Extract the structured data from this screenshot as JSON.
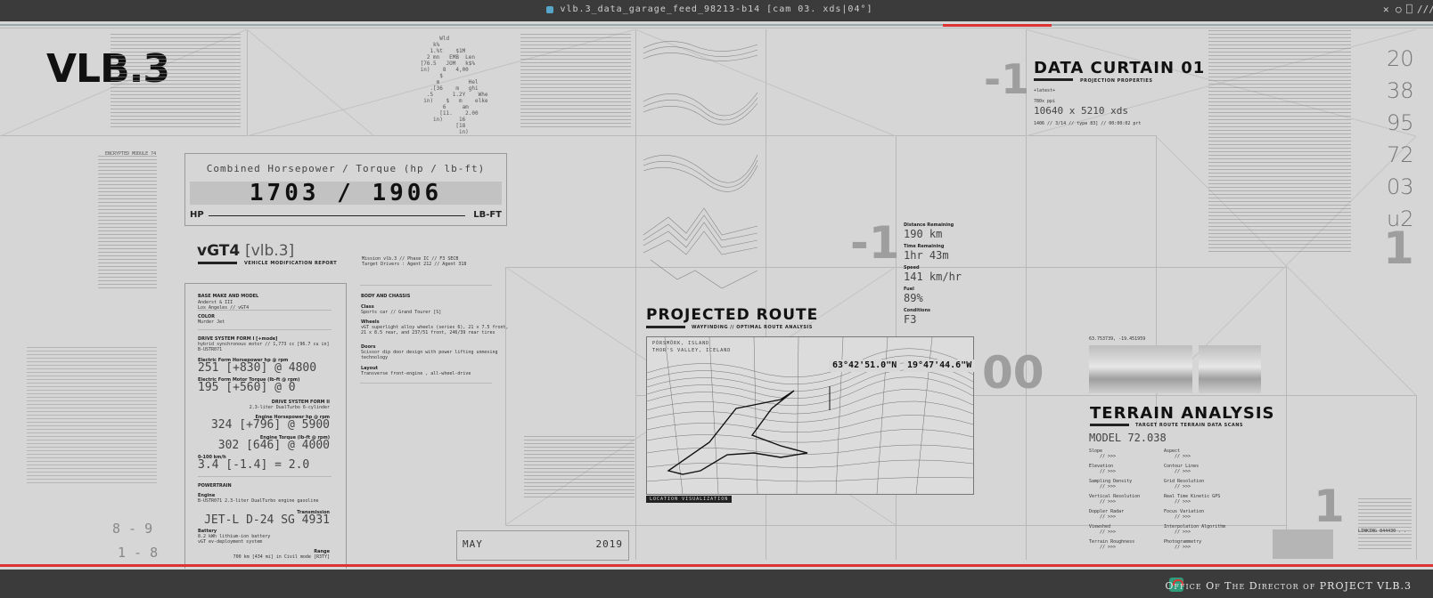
{
  "window": {
    "title": "vlb.3_data_garage_feed_98213-b14 [cam 03. xds|04°]",
    "controls": [
      "✕",
      "○",
      "⎕",
      "///"
    ]
  },
  "logo": "VLB.3",
  "left_text": {
    "encrypted": "ENCRYPTED MODULE 74",
    "nums_bottom": [
      "8 - 9",
      "1 - 8"
    ]
  },
  "horsepower": {
    "label": "Combined Horsepower / Torque (hp / lb-ft)",
    "value": "1703 / 1906",
    "left_unit": "HP",
    "right_unit": "LB-FT"
  },
  "report": {
    "title": "vGT4",
    "title_bracket": "[vlb.3]",
    "subtitle": "VEHICLE MODIFICATION REPORT",
    "meta1": "Mission vlb.3 // Phase IC // F3 SECB",
    "meta2": "Target Drivers : Agent 212 // Agent 318"
  },
  "specs": {
    "base_label": "BASE MAKE AND MODEL",
    "base_value": "Anderst & III\nLos Angeles // vGT4",
    "color_label": "COLOR",
    "color_value": "Murder Jet",
    "drive1_label": "DRIVE SYSTEM FORM I [+mode]",
    "drive1_value": "hybrid synchronous motor // 1,773 cc [96.7 cu in]\nB-USTR071",
    "ehp_label": "Electric Form Horsepower hp @ rpm",
    "ehp_value": "251 [+830] @ 4800",
    "etq_label": "Electric Form Motor Torque (lb-ft @ rpm)",
    "etq_value": "195 [+560] @ 0",
    "drive2_label": "DRIVE SYSTEM FORM II",
    "drive2_value": "2.3-liter DualTurbo 6-cylinder",
    "ehp2_label": "Engine Horsepower hp @ rpm",
    "ehp2_value": "324 [+796] @ 5900",
    "etq2_label": "Engine Torque (lb-ft @ rpm)",
    "etq2_value": "302 [646] @ 4000",
    "accel_label": "0-100 km/h",
    "accel_value": "3.4 [-1.4] = 2.0",
    "powertrain_label": "POWERTRAIN",
    "engine_label": "Engine",
    "engine_value": "B-USTR071 2.3-liter DualTurbo engine gasoline",
    "trans_label": "Transmission",
    "trans_value": "JET-L D-24 SG 4931",
    "battery_label": "Battery",
    "battery_value": "8.2 kWh lithium-ion battery\nvGT ev-deployment system",
    "range_label": "Range",
    "range_value": "700 km [434 mi] in Civil mode [R3TY]"
  },
  "body": {
    "label": "BODY AND CHASSIS",
    "class_label": "Class",
    "class_value": "Sports car // Grand Tourer [S]",
    "wheels_label": "Wheels",
    "wheels_value": "vGT superlight alloy wheels (series 6), 21 x 7.5 front,\n21 x 8.5 rear, and 237/51 front, 246/39 rear tires",
    "doors_label": "Doors",
    "doors_value": "Scissor dip door design with power lifting unmoving\ntechnology",
    "layout_label": "Layout",
    "layout_value": "Transverse front-engine , all-wheel-drive"
  },
  "date": {
    "month": "MAY",
    "year": "2019"
  },
  "big_numbers": {
    "n1": "-1",
    "n2": "-1",
    "n3": "00",
    "n4": "1",
    "n5": "1"
  },
  "data_curtain": {
    "title": "DATA CURTAIN 01",
    "subtitle": "PROJECTION PROPERTIES",
    "latest": "+latest+",
    "ppi": "780x ppi",
    "size": "10640 x 5210 xds",
    "meta": "1406 // 3/14 // type 83] // 00:00:02 prt"
  },
  "right_numbers": [
    "20",
    "38",
    "95",
    "72",
    "03",
    "u2"
  ],
  "route": {
    "title": "PROJECTED ROUTE",
    "subtitle": "WAYFINDING // OPTIMAL ROUTE ANALYSIS",
    "place1": "PÓRSMÖRK, ISLAND",
    "place2": "THOR'S VALLEY, ICELAND",
    "lat": "63°42'51.0\"N",
    "lon": "19°47'44.6\"W",
    "footer": "LOCATION VISUALIZATION"
  },
  "stats": [
    {
      "label": "Distance Remaining",
      "value": "190 km"
    },
    {
      "label": "Time Remaining",
      "value": "1hr 43m"
    },
    {
      "label": "Speed",
      "value": "141 km/hr"
    },
    {
      "label": "Fuel",
      "value": "89%"
    },
    {
      "label": "Conditions",
      "value": "F3"
    }
  ],
  "terrain": {
    "coords": "63.753739, -19.451959",
    "title": "TERRAIN ANALYSIS",
    "subtitle": "TARGET ROUTE TERRAIN DATA SCANS",
    "model": "MODEL 72.038",
    "left": [
      "Slope",
      "Elevation",
      "Sampling Density",
      "Vertical Resolution",
      "Doppler Radar",
      "Viewshed",
      "Terrain Roughness"
    ],
    "right": [
      "Aspect",
      "Contour Lines",
      "Grid Resolution",
      "Real Time Kinetic GPS",
      "Focus Variation",
      "Interpolation Algorithm",
      "Photogrammetry"
    ],
    "placeholder": "// >>>",
    "linking": "LINKING 844430 . ."
  },
  "footer": "Office Of The Director of PROJECT VLB.3"
}
